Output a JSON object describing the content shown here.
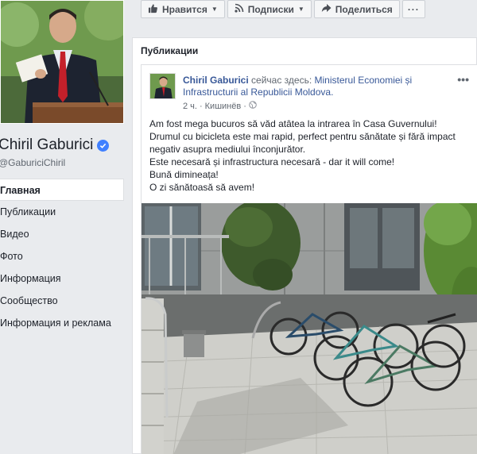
{
  "profile": {
    "name": "Chiril Gaburici",
    "handle": "@GaburiciChiril"
  },
  "nav": {
    "items": [
      {
        "label": "Главная"
      },
      {
        "label": "Публикации"
      },
      {
        "label": "Видео"
      },
      {
        "label": "Фото"
      },
      {
        "label": "Информация"
      },
      {
        "label": "Сообщество"
      },
      {
        "label": "Информация и реклама"
      }
    ]
  },
  "actions": {
    "like": "Нравится",
    "follow": "Подписки",
    "share": "Поделиться",
    "more": "···"
  },
  "section": {
    "title": "Публикации"
  },
  "post": {
    "author": "Chiril Gaburici",
    "here_text": "сейчас здесь:",
    "place": "Ministerul Economiei și Infrastructurii al Republicii Moldova.",
    "time": "2 ч.",
    "separator": "·",
    "city": "Кишинёв",
    "menu": "•••",
    "lines": [
      "Am fost mega bucuros să văd atâtea la intrarea în Casa Guvernului!",
      "Drumul cu bicicleta este mai rapid, perfect pentru sănătate și fără impact",
      "negativ asupra mediului înconjurător.",
      "Este necesară și infrastructura necesară - dar it will come!",
      "Bună dimineața!",
      "O zi sănătoasă să avem!"
    ]
  },
  "colors": {
    "link": "#385898",
    "verified": "#4080ff",
    "page_bg": "#e9ebee"
  }
}
